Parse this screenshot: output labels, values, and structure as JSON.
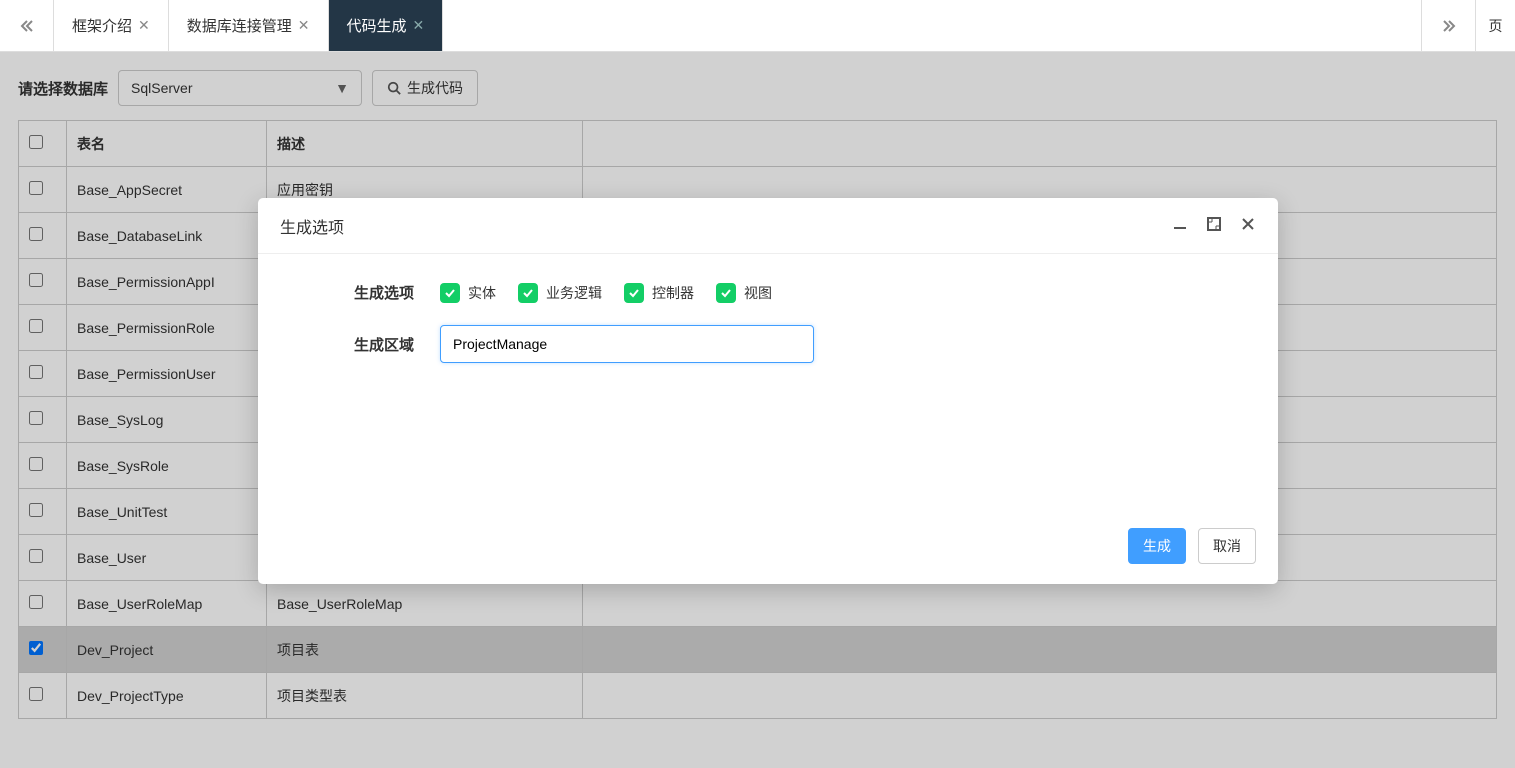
{
  "tabbar": {
    "tabs": [
      {
        "label": "框架介绍",
        "active": false
      },
      {
        "label": "数据库连接管理",
        "active": false
      },
      {
        "label": "代码生成",
        "active": true
      }
    ],
    "page_indicator": "页"
  },
  "toolbar": {
    "select_db_label": "请选择数据库",
    "db_value": "SqlServer",
    "gen_code_label": "生成代码"
  },
  "table": {
    "headers": {
      "name": "表名",
      "desc": "描述"
    },
    "rows": [
      {
        "name": "Base_AppSecret",
        "desc": "应用密钥",
        "checked": false,
        "selected": false
      },
      {
        "name": "Base_DatabaseLink",
        "desc": "",
        "checked": false,
        "selected": false
      },
      {
        "name": "Base_PermissionAppI",
        "desc": "",
        "checked": false,
        "selected": false
      },
      {
        "name": "Base_PermissionRole",
        "desc": "",
        "checked": false,
        "selected": false
      },
      {
        "name": "Base_PermissionUser",
        "desc": "",
        "checked": false,
        "selected": false
      },
      {
        "name": "Base_SysLog",
        "desc": "",
        "checked": false,
        "selected": false
      },
      {
        "name": "Base_SysRole",
        "desc": "",
        "checked": false,
        "selected": false
      },
      {
        "name": "Base_UnitTest",
        "desc": "",
        "checked": false,
        "selected": false
      },
      {
        "name": "Base_User",
        "desc": "",
        "checked": false,
        "selected": false
      },
      {
        "name": "Base_UserRoleMap",
        "desc": "Base_UserRoleMap",
        "checked": false,
        "selected": false
      },
      {
        "name": "Dev_Project",
        "desc": "项目表",
        "checked": true,
        "selected": true
      },
      {
        "name": "Dev_ProjectType",
        "desc": "项目类型表",
        "checked": false,
        "selected": false
      }
    ]
  },
  "dialog": {
    "title": "生成选项",
    "options_label": "生成选项",
    "options": [
      {
        "label": "实体",
        "checked": true
      },
      {
        "label": "业务逻辑",
        "checked": true
      },
      {
        "label": "控制器",
        "checked": true
      },
      {
        "label": "视图",
        "checked": true
      }
    ],
    "area_label": "生成区域",
    "area_value": "ProjectManage",
    "confirm_label": "生成",
    "cancel_label": "取消"
  }
}
